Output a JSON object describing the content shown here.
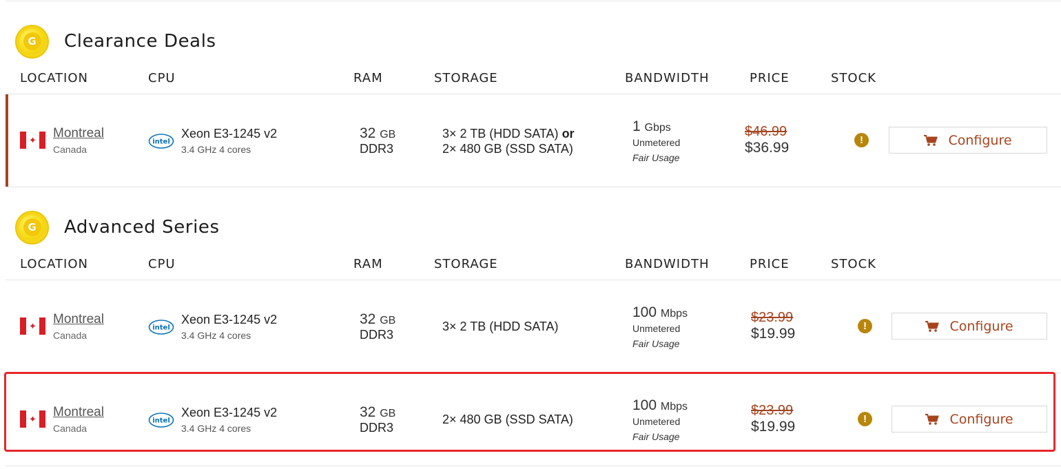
{
  "sections": [
    {
      "title": "Clearance Deals",
      "coin_letter": "G",
      "headers": [
        "LOCATION",
        "CPU",
        "RAM",
        "STORAGE",
        "BANDWIDTH",
        "PRICE",
        "STOCK"
      ],
      "rows": [
        {
          "city": "Montreal",
          "country": "Canada",
          "cpu": "Xeon E3-1245 v2",
          "cpu_detail": "3.4 GHz 4 cores",
          "ram_amount": "32",
          "ram_unit": "GB",
          "ram_type": "DDR3",
          "storage_line1": "3× 2 TB (HDD SATA)",
          "storage_or": "or",
          "storage_line2": "2× 480 GB (SSD SATA)",
          "bw_amount": "1",
          "bw_unit": "Gbps",
          "bw_type": "Unmetered",
          "bw_note": "Fair Usage",
          "price_old": "$46.99",
          "price_new": "$36.99",
          "stock_icon": "!",
          "configure": "Configure"
        }
      ]
    },
    {
      "title": "Advanced Series",
      "coin_letter": "G",
      "headers": [
        "LOCATION",
        "CPU",
        "RAM",
        "STORAGE",
        "BANDWIDTH",
        "PRICE",
        "STOCK"
      ],
      "rows": [
        {
          "city": "Montreal",
          "country": "Canada",
          "cpu": "Xeon E3-1245 v2",
          "cpu_detail": "3.4 GHz 4 cores",
          "ram_amount": "32",
          "ram_unit": "GB",
          "ram_type": "DDR3",
          "storage_line1": "3× 2 TB (HDD SATA)",
          "bw_amount": "100",
          "bw_unit": "Mbps",
          "bw_type": "Unmetered",
          "bw_note": "Fair Usage",
          "price_old": "$23.99",
          "price_new": "$19.99",
          "stock_icon": "!",
          "configure": "Configure"
        },
        {
          "city": "Montreal",
          "country": "Canada",
          "cpu": "Xeon E3-1245 v2",
          "cpu_detail": "3.4 GHz 4 cores",
          "ram_amount": "32",
          "ram_unit": "GB",
          "ram_type": "DDR3",
          "storage_line1": "2× 480 GB (SSD SATA)",
          "bw_amount": "100",
          "bw_unit": "Mbps",
          "bw_type": "Unmetered",
          "bw_note": "Fair Usage",
          "price_old": "$23.99",
          "price_new": "$19.99",
          "stock_icon": "!",
          "configure": "Configure"
        }
      ]
    }
  ],
  "icons": {
    "coin": "gold-coin-icon",
    "flag": "canada-flag-icon",
    "cpu_brand": "intel-logo-icon",
    "stock": "exclamation-circle-icon",
    "cart": "shopping-cart-icon"
  },
  "brand_logo_text": "intel",
  "colors": {
    "accent": "#a6441e",
    "stock_warning": "#b8860b",
    "highlight": "#e8272a",
    "intel_blue": "#0a72b8"
  }
}
